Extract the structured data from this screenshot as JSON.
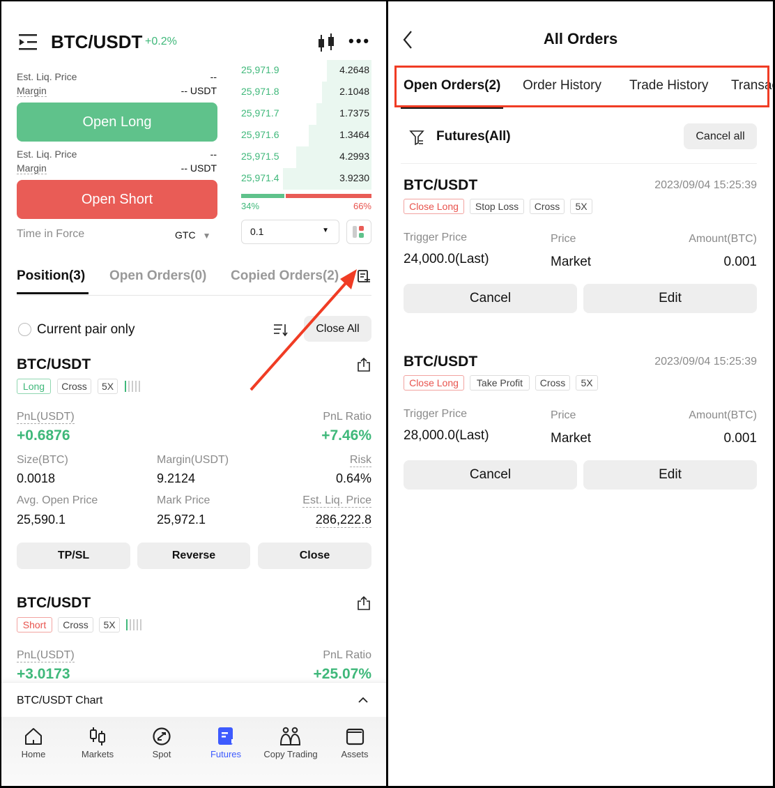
{
  "left": {
    "header": {
      "pair": "BTC/USDT",
      "change": "+0.2%"
    },
    "order_form": {
      "long": {
        "liq_label": "Est. Liq. Price",
        "liq_value": "--",
        "margin_label": "Margin",
        "margin_value": "-- USDT",
        "button": "Open Long"
      },
      "short": {
        "liq_label": "Est. Liq. Price",
        "liq_value": "--",
        "margin_label": "Margin",
        "margin_value": "-- USDT",
        "button": "Open Short"
      },
      "tif_label": "Time in Force",
      "tif_value": "GTC"
    },
    "orderbook": {
      "rows": [
        {
          "price": "25,971.9",
          "size": "4.2648"
        },
        {
          "price": "25,971.8",
          "size": "2.1048"
        },
        {
          "price": "25,971.7",
          "size": "1.7375"
        },
        {
          "price": "25,971.6",
          "size": "1.3464"
        },
        {
          "price": "25,971.5",
          "size": "4.2993"
        },
        {
          "price": "25,971.4",
          "size": "3.9230"
        }
      ],
      "buy_pct": "34%",
      "sell_pct": "66%",
      "precision": "0.1"
    },
    "tabs": [
      "Position(3)",
      "Open Orders(0)",
      "Copied Orders(2)"
    ],
    "current_pair_only": "Current pair only",
    "close_all": "Close All",
    "positions": [
      {
        "pair": "BTC/USDT",
        "side": "Long",
        "mode": "Cross",
        "leverage": "5X",
        "pnl_label": "PnL(USDT)",
        "pnl": "+0.6876",
        "ratio_label": "PnL Ratio",
        "ratio": "+7.46%",
        "size_label": "Size(BTC)",
        "size": "0.0018",
        "margin_label": "Margin(USDT)",
        "margin": "9.2124",
        "risk_label": "Risk",
        "risk": "0.64%",
        "avg_label": "Avg. Open Price",
        "avg": "25,590.1",
        "mark_label": "Mark Price",
        "mark": "25,972.1",
        "liq_label": "Est. Liq. Price",
        "liq": "286,222.8",
        "buttons": [
          "TP/SL",
          "Reverse",
          "Close"
        ]
      },
      {
        "pair": "BTC/USDT",
        "side": "Short",
        "mode": "Cross",
        "leverage": "5X",
        "pnl_label": "PnL(USDT)",
        "pnl": "+3.0173",
        "ratio_label": "PnL Ratio",
        "ratio": "+25.07%"
      }
    ],
    "chart_bar": "BTC/USDT Chart",
    "nav": [
      "Home",
      "Markets",
      "Spot",
      "Futures",
      "Copy Trading",
      "Assets"
    ],
    "colors": {
      "green": "#5fc28b",
      "red": "#e95c56",
      "accent": "#3d5afe",
      "annotation": "#f03c24"
    }
  },
  "right": {
    "title": "All Orders",
    "tabs": [
      "Open Orders(2)",
      "Order History",
      "Trade History",
      "Transactions"
    ],
    "filter": "Futures(All)",
    "cancel_all": "Cancel all",
    "orders": [
      {
        "pair": "BTC/USDT",
        "time": "2023/09/04 15:25:39",
        "tags": [
          "Close Long",
          "Stop Loss",
          "Cross",
          "5X"
        ],
        "trigger_label": "Trigger Price",
        "trigger": "24,000.0(Last)",
        "price_label": "Price",
        "price": "Market",
        "amount_label": "Amount(BTC)",
        "amount": "0.001",
        "cancel": "Cancel",
        "edit": "Edit"
      },
      {
        "pair": "BTC/USDT",
        "time": "2023/09/04 15:25:39",
        "tags": [
          "Close Long",
          "Take Profit",
          "Cross",
          "5X"
        ],
        "trigger_label": "Trigger Price",
        "trigger": "28,000.0(Last)",
        "price_label": "Price",
        "price": "Market",
        "amount_label": "Amount(BTC)",
        "amount": "0.001",
        "cancel": "Cancel",
        "edit": "Edit"
      }
    ]
  }
}
